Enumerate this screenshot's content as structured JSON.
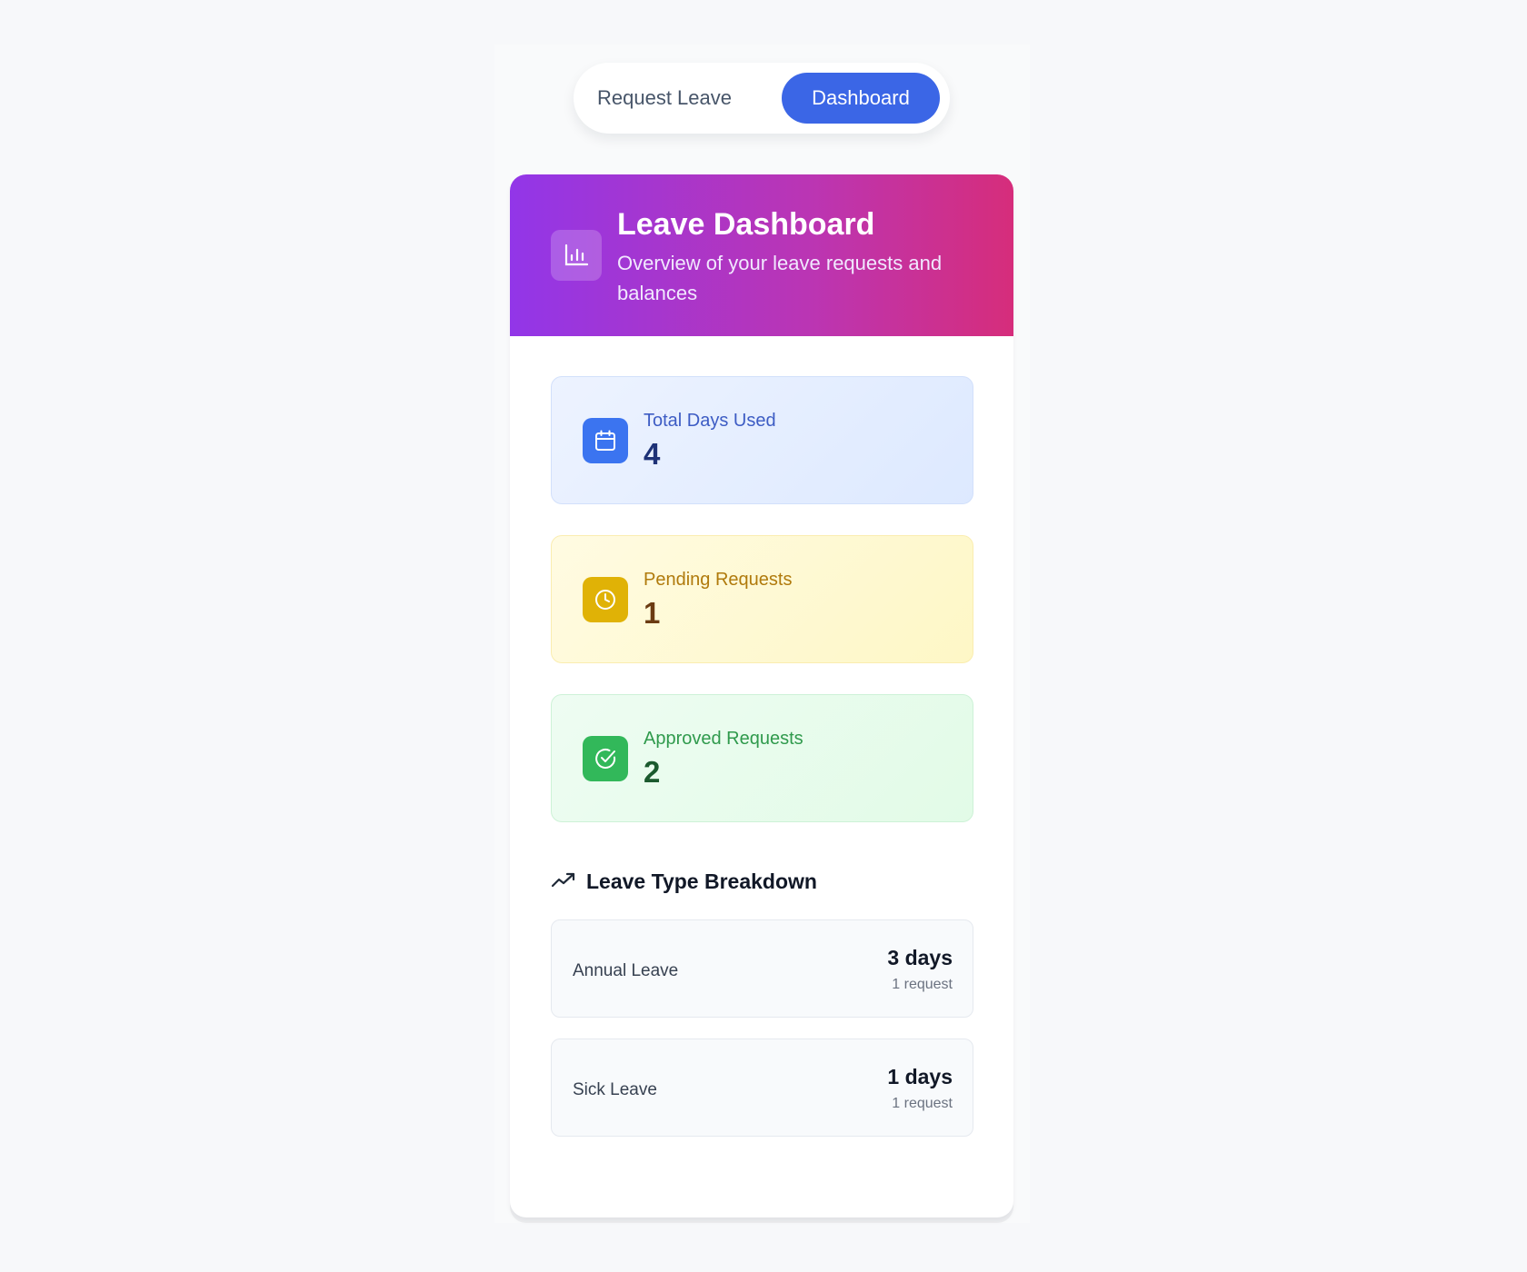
{
  "tabs": [
    {
      "label": "Request Leave",
      "active": false
    },
    {
      "label": "Dashboard",
      "active": true
    }
  ],
  "header": {
    "icon": "bar-chart-icon",
    "title": "Leave Dashboard",
    "subtitle": "Overview of your leave requests and balances"
  },
  "stats": [
    {
      "icon": "calendar-icon",
      "label": "Total Days Used",
      "value": "4",
      "color": "#3b74f0"
    },
    {
      "icon": "clock-icon",
      "label": "Pending Requests",
      "value": "1",
      "color": "#e0b206"
    },
    {
      "icon": "check-circle-icon",
      "label": "Approved Requests",
      "value": "2",
      "color": "#32b85a"
    }
  ],
  "breakdown": {
    "icon": "trending-up-icon",
    "title": "Leave Type Breakdown",
    "items": [
      {
        "name": "Annual Leave",
        "days": "3 days",
        "requests": "1 request"
      },
      {
        "name": "Sick Leave",
        "days": "1 days",
        "requests": "1 request"
      }
    ]
  },
  "colors": {
    "accent": "#3b66e6",
    "header_gradient_start": "#9236e8",
    "header_gradient_end": "#d62d7b"
  }
}
